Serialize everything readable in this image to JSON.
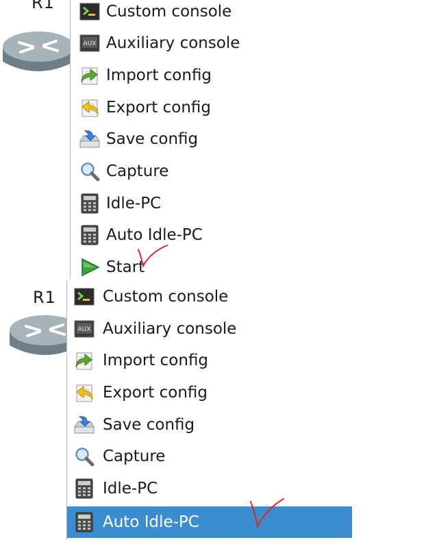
{
  "top_panel": {
    "node_label": "R1",
    "menu_items": [
      {
        "label": "Custom console",
        "icon": "custom-console-icon"
      },
      {
        "label": "Auxiliary console",
        "icon": "auxiliary-console-icon"
      },
      {
        "label": "Import config",
        "icon": "import-config-icon"
      },
      {
        "label": "Export config",
        "icon": "export-config-icon"
      },
      {
        "label": "Save config",
        "icon": "save-config-icon"
      },
      {
        "label": "Capture",
        "icon": "capture-magnifier-icon"
      },
      {
        "label": "Idle-PC",
        "icon": "idle-pc-calculator-icon"
      },
      {
        "label": "Auto Idle-PC",
        "icon": "auto-idle-pc-calculator-icon"
      },
      {
        "label": "Start",
        "icon": "start-play-icon"
      }
    ]
  },
  "bottom_panel": {
    "node_label": "R1",
    "menu_items": [
      {
        "label": "Custom console",
        "icon": "custom-console-icon"
      },
      {
        "label": "Auxiliary console",
        "icon": "auxiliary-console-icon"
      },
      {
        "label": "Import config",
        "icon": "import-config-icon"
      },
      {
        "label": "Export config",
        "icon": "export-config-icon"
      },
      {
        "label": "Save config",
        "icon": "save-config-icon"
      },
      {
        "label": "Capture",
        "icon": "capture-magnifier-icon"
      },
      {
        "label": "Idle-PC",
        "icon": "idle-pc-calculator-icon"
      },
      {
        "label": "Auto Idle-PC",
        "icon": "auto-idle-pc-calculator-icon",
        "selected": true
      }
    ]
  },
  "icon_text": {
    "aux": "AUX",
    "console_prompt": ">_"
  },
  "colors": {
    "selection": "#3c8dd0",
    "annotation_check": "#e0242a",
    "router_body": "#8a9aa4"
  }
}
